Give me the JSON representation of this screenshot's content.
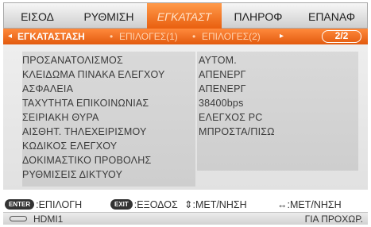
{
  "tabs": [
    {
      "label": "ΕΙΣΟΔ",
      "active": false
    },
    {
      "label": "ΡΥΘΜΙΣΗ",
      "active": false
    },
    {
      "label": "ΕΓΚΑΤΑΣΤ",
      "active": true
    },
    {
      "label": "ΠΛΗΡΟΦ",
      "active": false
    },
    {
      "label": "ΕΠΑΝΑΦ",
      "active": false
    }
  ],
  "subtabs": {
    "left_arrow": "◂",
    "current": "ΕΓΚΑΤΑΣΤΑΣΗ",
    "sep1": "•",
    "item2": "ΕΠΙΛΟΓΕΣ(1)",
    "sep2": "•",
    "item3": "ΕΠΙΛΟΓΕΣ(2)",
    "right_arrow": "▸",
    "page": "2/2"
  },
  "settings": [
    {
      "label": "ΠΡΟΣΑΝΑΤΟΛΙΣΜΟΣ",
      "value": "ΑΥΤΟΜ."
    },
    {
      "label": "ΚΛΕΙΔΩΜΑ ΠΙΝΑΚΑ ΕΛΕΓΧΟΥ",
      "value": "ΑΠΕΝΕΡΓ"
    },
    {
      "label": "ΑΣΦΑΛΕΙΑ",
      "value": "ΑΠΕΝΕΡΓ"
    },
    {
      "label": "ΤΑΧΥΤΗΤΑ ΕΠΙΚΟΙΝΩΝΙΑΣ",
      "value": "38400bps"
    },
    {
      "label": "ΣΕΙΡΙΑΚΗ ΘΥΡΑ",
      "value": "ΕΛΕΓΧΟΣ PC"
    },
    {
      "label": "ΑΙΣΘΗΤ. ΤΗΛΕΧΕΙΡΙΣΜΟΥ",
      "value": "ΜΠΡΟΣΤΑ/ΠΙΣΩ"
    },
    {
      "label": "ΚΩΔΙΚΟΣ ΕΛΕΓΧΟΥ",
      "value": ""
    },
    {
      "label": "ΔΟΚΙΜΑΣΤΙΚΟ ΠΡΟΒΟΛΗΣ",
      "value": ""
    },
    {
      "label": "ΡΥΘΜΙΣΕΙΣ ΔΙΚΤΥΟΥ",
      "value": ""
    }
  ],
  "help": {
    "enter_key": "ENTER",
    "enter_text": ":ΕΠΙΛΟΓΗ",
    "exit_key": "EXIT",
    "exit_text": ":ΕΞΟΔΟΣ",
    "updown_text": "⇕:ΜΕΤ/ΝΗΣΗ",
    "leftright_text": "↔:ΜΕΤ/ΝΗΣΗ"
  },
  "status": {
    "source_icon": "hdmi-connector-icon",
    "source": "HDMI1",
    "right": "ΓΙΑ ΠΡΟΧΩΡ."
  },
  "colors": {
    "accent": "#f07020",
    "panel": "#e6e6e6"
  }
}
